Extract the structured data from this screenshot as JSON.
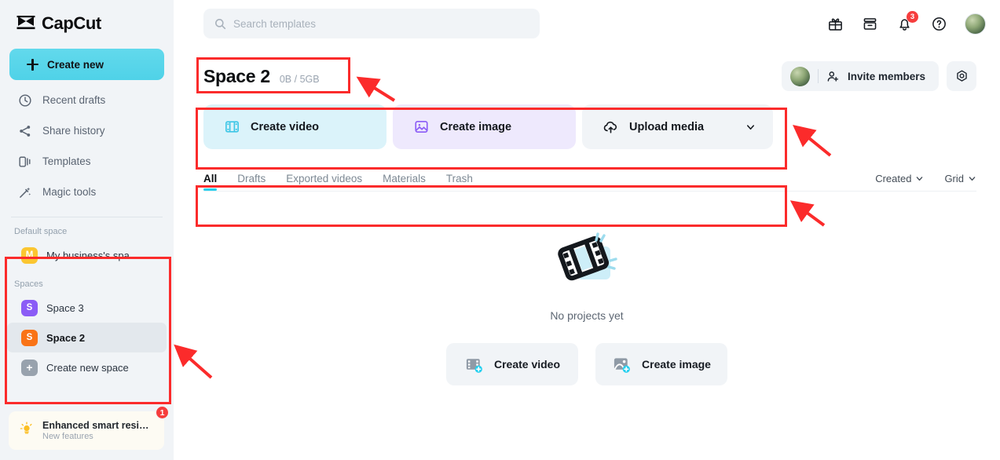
{
  "brand": {
    "name": "CapCut",
    "accent": "#25d0ef",
    "alert": "#f63d3d",
    "annotation": "#fb2b2b"
  },
  "sidebar": {
    "create_new_label": "Create new",
    "nav_items": [
      {
        "label": "Recent drafts",
        "icon": "clock-icon"
      },
      {
        "label": "Share history",
        "icon": "share-icon"
      },
      {
        "label": "Templates",
        "icon": "templates-icon"
      },
      {
        "label": "Magic tools",
        "icon": "magic-wand-icon"
      }
    ],
    "default_space_label": "Default space",
    "default_space": {
      "initial": "M",
      "name": "My business's spa…",
      "color": "#fbc631"
    },
    "spaces_label": "Spaces",
    "spaces": [
      {
        "initial": "S",
        "name": "Space 3",
        "color": "#8b5cf6",
        "active": false
      },
      {
        "initial": "S",
        "name": "Space 2",
        "color": "#f97316",
        "active": true
      }
    ],
    "create_space": {
      "initial": "+",
      "name": "Create new space",
      "color": "#98a2ad"
    },
    "promo": {
      "title": "Enhanced smart resi…",
      "subtitle": "New features",
      "badge": "1"
    }
  },
  "topbar": {
    "search_placeholder": "Search templates",
    "icons": [
      {
        "name": "gift-icon"
      },
      {
        "name": "archive-icon"
      },
      {
        "name": "bell-icon",
        "badge": "3"
      },
      {
        "name": "help-icon"
      }
    ]
  },
  "header": {
    "space_title": "Space 2",
    "storage": "0B / 5GB",
    "invite_label": "Invite members",
    "settings_icon": "gear-icon"
  },
  "actions": [
    {
      "label": "Create video",
      "icon": "film-icon",
      "bg": "#dbf3fa"
    },
    {
      "label": "Create image",
      "icon": "image-icon",
      "bg": "#eee9fd"
    },
    {
      "label": "Upload media",
      "icon": "cloud-upload-icon",
      "bg": "#f1f4f7",
      "has_chevron": true
    }
  ],
  "tabs": [
    {
      "label": "All",
      "active": true
    },
    {
      "label": "Drafts",
      "active": false
    },
    {
      "label": "Exported videos",
      "active": false
    },
    {
      "label": "Materials",
      "active": false
    },
    {
      "label": "Trash",
      "active": false
    }
  ],
  "filters": [
    {
      "label": "Created"
    },
    {
      "label": "Grid"
    }
  ],
  "empty_state": {
    "message": "No projects yet",
    "buttons": [
      {
        "label": "Create video",
        "icon": "film-plus-icon"
      },
      {
        "label": "Create image",
        "icon": "image-plus-icon"
      }
    ]
  }
}
